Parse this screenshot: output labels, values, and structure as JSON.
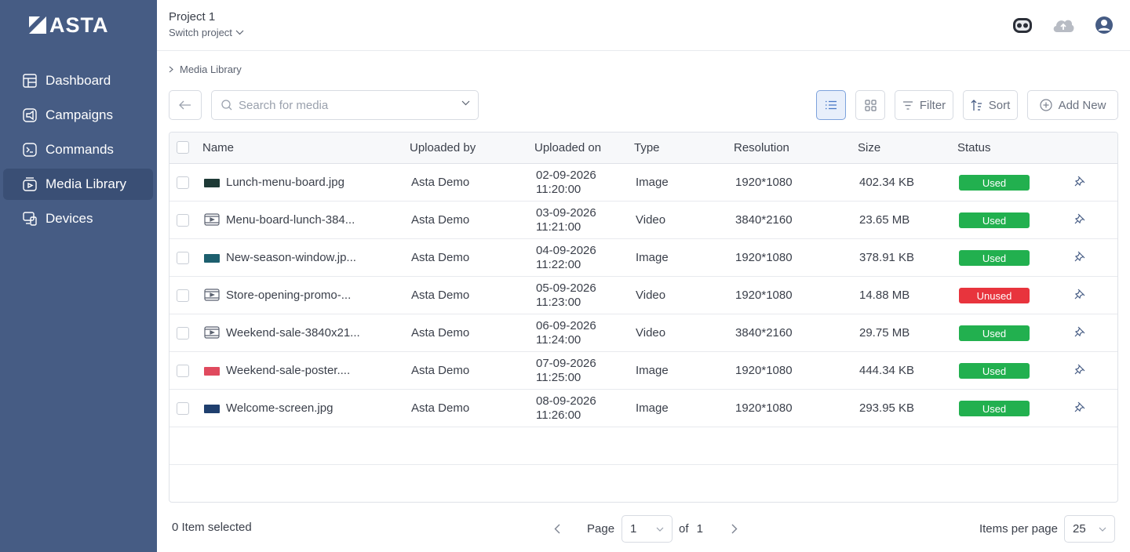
{
  "app": {
    "logo_text": "ASTA"
  },
  "sidebar": {
    "items": [
      {
        "label": "Dashboard",
        "icon": "dashboard-icon",
        "active": false
      },
      {
        "label": "Campaigns",
        "icon": "campaigns-icon",
        "active": false
      },
      {
        "label": "Commands",
        "icon": "commands-icon",
        "active": false
      },
      {
        "label": "Media Library",
        "icon": "media-library-icon",
        "active": true
      },
      {
        "label": "Devices",
        "icon": "devices-icon",
        "active": false
      }
    ]
  },
  "header": {
    "project_title": "Project 1",
    "switch_label": "Switch project",
    "icons": [
      "robot-icon",
      "cloud-upload-icon",
      "user-avatar-icon"
    ]
  },
  "breadcrumb": {
    "current": "Media Library"
  },
  "toolbar": {
    "search_placeholder": "Search for media",
    "filter_label": "Filter",
    "sort_label": "Sort",
    "add_label": "Add New"
  },
  "table": {
    "headers": [
      "Name",
      "Uploaded by",
      "Uploaded on",
      "Type",
      "Resolution",
      "Size",
      "Status"
    ],
    "rows": [
      {
        "name": "Lunch-menu-board.jpg",
        "by": "Asta Demo",
        "date": "02-09-2026",
        "time": "11:20:00",
        "type": "Image",
        "resolution": "1920*1080",
        "size": "402.34 KB",
        "status": "Used",
        "thumb": "#1e3a36"
      },
      {
        "name": "Menu-board-lunch-384...",
        "by": "Asta Demo",
        "date": "03-09-2026",
        "time": "11:21:00",
        "type": "Video",
        "resolution": "3840*2160",
        "size": "23.65 MB",
        "status": "Used",
        "thumb": ""
      },
      {
        "name": "New-season-window.jp...",
        "by": "Asta Demo",
        "date": "04-09-2026",
        "time": "11:22:00",
        "type": "Image",
        "resolution": "1920*1080",
        "size": "378.91 KB",
        "status": "Used",
        "thumb": "#1d5f6e"
      },
      {
        "name": "Store-opening-promo-...",
        "by": "Asta Demo",
        "date": "05-09-2026",
        "time": "11:23:00",
        "type": "Video",
        "resolution": "1920*1080",
        "size": "14.88 MB",
        "status": "Unused",
        "thumb": ""
      },
      {
        "name": "Weekend-sale-3840x21...",
        "by": "Asta Demo",
        "date": "06-09-2026",
        "time": "11:24:00",
        "type": "Video",
        "resolution": "3840*2160",
        "size": "29.75 MB",
        "status": "Used",
        "thumb": ""
      },
      {
        "name": "Weekend-sale-poster....",
        "by": "Asta Demo",
        "date": "07-09-2026",
        "time": "11:25:00",
        "type": "Image",
        "resolution": "1920*1080",
        "size": "444.34 KB",
        "status": "Used",
        "thumb": "#e04a5e"
      },
      {
        "name": "Welcome-screen.jpg",
        "by": "Asta Demo",
        "date": "08-09-2026",
        "time": "11:26:00",
        "type": "Image",
        "resolution": "1920*1080",
        "size": "293.95 KB",
        "status": "Used",
        "thumb": "#1f3f6e"
      }
    ]
  },
  "footer": {
    "selected_text": "0 Item selected",
    "page_label": "Page",
    "page_value": "1",
    "of_label": "of",
    "total_pages": "1",
    "items_per_page_label": "Items per page",
    "items_per_page_value": "25"
  },
  "colors": {
    "sidebar": "#465c84",
    "used": "#22b04f",
    "unused": "#e8343d",
    "accent": "#7da2dc"
  }
}
